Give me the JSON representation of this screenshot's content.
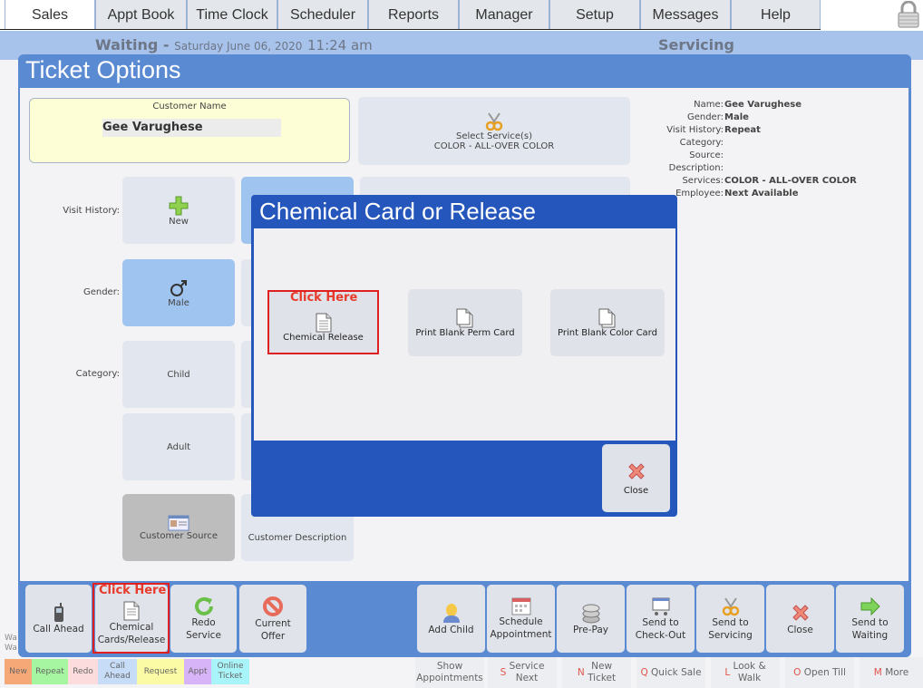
{
  "top_tabs": [
    {
      "label": "Sales",
      "active": true
    },
    {
      "label": "Appt Book",
      "active": false
    },
    {
      "label": "Time Clock",
      "active": false
    },
    {
      "label": "Scheduler",
      "active": false
    },
    {
      "label": "Reports",
      "active": false
    },
    {
      "label": "Manager",
      "active": false
    },
    {
      "label": "Setup",
      "active": false
    },
    {
      "label": "Messages",
      "active": false
    },
    {
      "label": "Help",
      "active": false
    }
  ],
  "lock_icon": "padlock-icon",
  "status": {
    "waiting_label": "Waiting -",
    "date": "Saturday June 06, 2020",
    "time": "11:24 am",
    "servicing_label": "Servicing"
  },
  "panel": {
    "title": "Ticket Options",
    "customer_name_label": "Customer Name",
    "customer_name_value": "Gee Varughese",
    "select_services_label": "Select Service(s)",
    "selected_service": "COLOR - ALL-OVER COLOR",
    "row_labels": {
      "visit_history": "Visit History:",
      "gender": "Gender:",
      "category": "Category:"
    },
    "tiles": {
      "new": "New",
      "male": "Male",
      "child": "Child",
      "adult": "Adult",
      "customer_source": "Customer Source",
      "customer_description": "Customer Description"
    },
    "info": [
      {
        "key": "Name:",
        "value": "Gee Varughese"
      },
      {
        "key": "Gender:",
        "value": "Male"
      },
      {
        "key": "Visit History:",
        "value": "Repeat"
      },
      {
        "key": "Category:",
        "value": ""
      },
      {
        "key": "Source:",
        "value": ""
      },
      {
        "key": "Description:",
        "value": ""
      },
      {
        "key": "Services:",
        "value": "COLOR - ALL-OVER COLOR"
      },
      {
        "key": "Employee:",
        "value": "Next Available"
      }
    ]
  },
  "modal": {
    "title": "Chemical Card or Release",
    "annotation": "Click Here",
    "buttons": [
      "Chemical Release",
      "Print Blank Perm Card",
      "Print Blank Color Card"
    ],
    "close_label": "Close"
  },
  "toolbar": {
    "annotation": "Click Here",
    "left_buttons": [
      "Call Ahead",
      "Chemical\nCards/Release",
      "Redo\nService",
      "Current\nOffer"
    ],
    "right_buttons": [
      "Add Child",
      "Schedule\nAppointment",
      "Pre-Pay",
      "Send to\nCheck-Out",
      "Send to\nServicing",
      "Close",
      "Send to\nWaiting"
    ]
  },
  "legend": [
    {
      "label": "New",
      "color": "#f7a877"
    },
    {
      "label": "Repeat",
      "color": "#a6f5a0"
    },
    {
      "label": "Redo",
      "color": "#fcdcdc"
    },
    {
      "label": "Call Ahead",
      "color": "#c6dcf7"
    },
    {
      "label": "Request",
      "color": "#fbfba6"
    },
    {
      "label": "Appt",
      "color": "#d7b4f7"
    },
    {
      "label": "Online Ticket",
      "color": "#a8f4f8"
    }
  ],
  "wa_text": "Wa\nWa",
  "shortcuts": [
    {
      "key": "",
      "label": "Show\nAppointments"
    },
    {
      "key": "S",
      "label": "Service\nNext"
    },
    {
      "key": "N",
      "label": "New\nTicket"
    },
    {
      "key": "Q",
      "label": "Quick Sale"
    },
    {
      "key": "L",
      "label": "Look &\nWalk"
    },
    {
      "key": "O",
      "label": "Open Till"
    },
    {
      "key": "M",
      "label": "More"
    }
  ]
}
